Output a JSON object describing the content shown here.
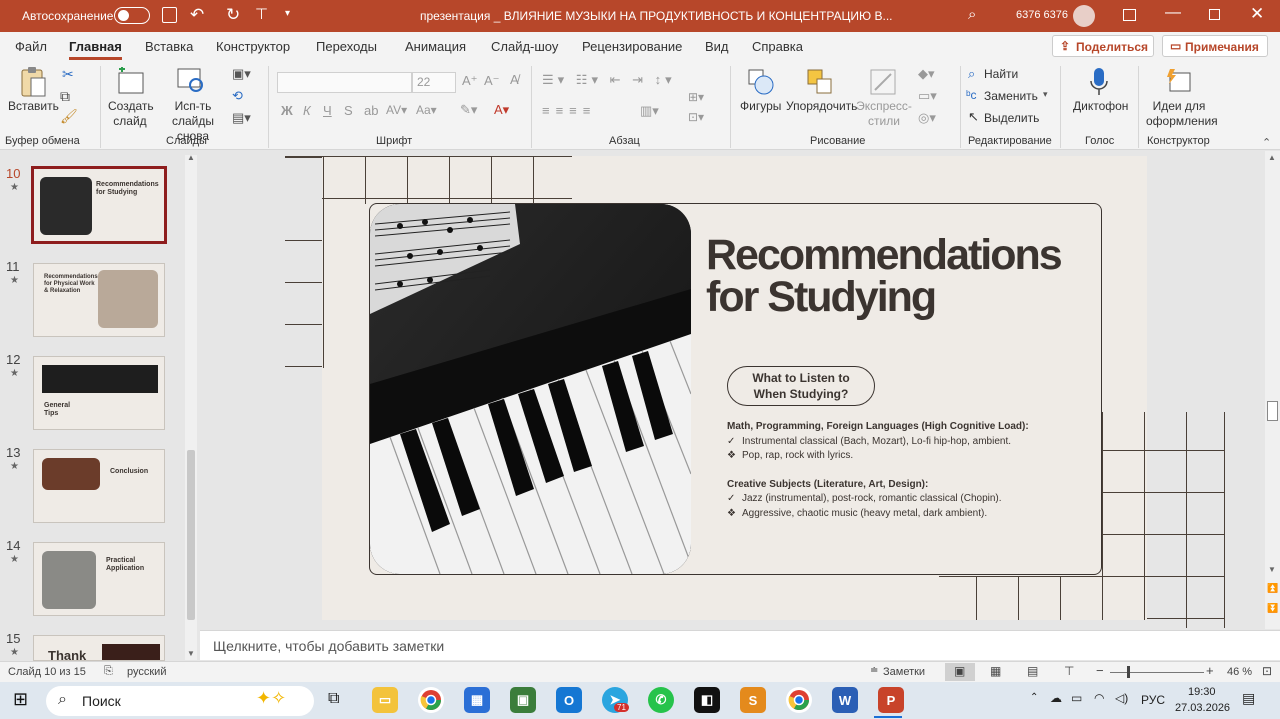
{
  "titlebar": {
    "autosave_label": "Автосохранение",
    "doc_title": "презентация _ ВЛИЯНИЕ МУЗЫКИ НА ПРОДУКТИВНОСТЬ И КОНЦЕНТРАЦИЮ В...",
    "user": "6376 6376"
  },
  "tabs": [
    "Файл",
    "Главная",
    "Вставка",
    "Конструктор",
    "Переходы",
    "Анимация",
    "Слайд-шоу",
    "Рецензирование",
    "Вид",
    "Справка"
  ],
  "share_label": "Поделиться",
  "comments_label": "Примечания",
  "ribbon": {
    "paste": "Вставить",
    "new_slide": "Создать слайд",
    "reuse_slides": "Исп-ть слайды снова",
    "font_size": "22",
    "shapes": "Фигуры",
    "arrange": "Упорядочить",
    "quick_styles": "Экспресс-стили",
    "find": "Найти",
    "replace": "Заменить",
    "select": "Выделить",
    "dictate": "Диктофон",
    "designer": "Идеи для оформления",
    "groups": {
      "clipboard": "Буфер обмена",
      "slides": "Слайды",
      "font": "Шрифт",
      "paragraph": "Абзац",
      "drawing": "Рисование",
      "editing": "Редактирование",
      "voice": "Голос",
      "designer": "Конструктор"
    }
  },
  "thumbnails": [
    {
      "num": "10",
      "title": "Recommendations for Studying"
    },
    {
      "num": "11",
      "title": "Recommendations for Physical Work & Relaxation"
    },
    {
      "num": "12",
      "title": "General Tips"
    },
    {
      "num": "13",
      "title": "Conclusion"
    },
    {
      "num": "14",
      "title": "Practical Application"
    },
    {
      "num": "15",
      "title": "Thank"
    }
  ],
  "slide": {
    "title_line1": "Recommendations",
    "title_line2": "for Studying",
    "pill_line1": "What to Listen to",
    "pill_line2": "When Studying?",
    "section1_heading": "Math, Programming, Foreign Languages (High Cognitive Load):",
    "section1_yes": "Instrumental classical (Bach, Mozart), Lo-fi hip-hop, ambient.",
    "section1_no": "Pop, rap, rock with lyrics.",
    "section2_heading": "Creative Subjects (Literature, Art, Design):",
    "section2_yes": "Jazz (instrumental), post-rock, romantic classical (Chopin).",
    "section2_no": "Aggressive, chaotic music (heavy metal, dark ambient).",
    "check_glyph": "✓",
    "cross_glyph": "❖"
  },
  "notes_placeholder": "Щелкните, чтобы добавить заметки",
  "status": {
    "slide_count": "Слайд 10 из 15",
    "language": "русский",
    "notes_btn": "Заметки",
    "zoom": "46 %"
  },
  "taskbar": {
    "search": "Поиск",
    "lang": "РУС",
    "time": "19:30",
    "date": "27.03.2026",
    "telegram_badge": "71"
  },
  "colors": {
    "accent": "#b7472a",
    "slide_bg": "#efebe6",
    "slide_text": "#3b3430"
  }
}
